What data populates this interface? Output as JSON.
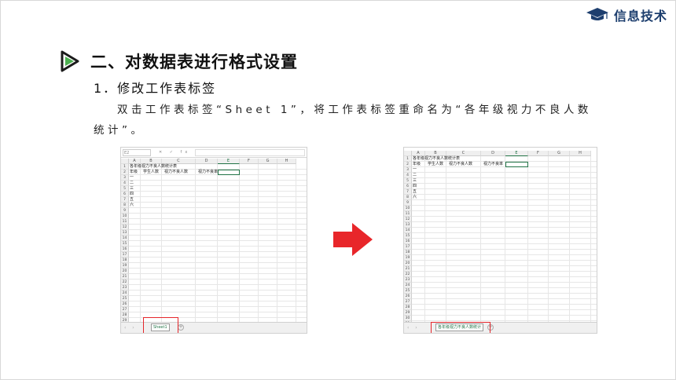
{
  "brand": {
    "text": "信息技术",
    "icon": "graduation-cap-icon",
    "color": "#1d3e6e"
  },
  "heading": {
    "icon": "play-triangle-icon",
    "title": "二、对数据表进行格式设置"
  },
  "subheading": "1．修改工作表标签",
  "paragraph": "双击工作表标签“Sheet 1”，将工作表标签重命名为“各年级视力不良人数统计”。",
  "colors": {
    "accent_green": "#217346",
    "highlight_red": "#e5262b",
    "arrow_red": "#e8262a"
  },
  "left_sheet": {
    "namebox": "E2",
    "fx": "✕ ✓ fx",
    "columns": [
      "A",
      "B",
      "C",
      "D",
      "E",
      "F",
      "G",
      "H"
    ],
    "selected_column": "E",
    "row_count": 30,
    "title_cell": "各年级视力不良人数统计表",
    "header_row": [
      "年级",
      "学生人数",
      "视力不良人数",
      "视力不良率"
    ],
    "grades": [
      "一",
      "二",
      "三",
      "四",
      "五",
      "六"
    ],
    "tab_label": "Sheet1",
    "tab_plus": "+"
  },
  "right_sheet": {
    "columns": [
      "A",
      "B",
      "C",
      "D",
      "E",
      "F",
      "G",
      "H"
    ],
    "selected_column": "E",
    "row_count": 31,
    "title_cell": "各年级视力不良人数统计表",
    "header_row": [
      "年级",
      "学生人数",
      "视力不良人数",
      "视力不良率"
    ],
    "grades": [
      "一",
      "二",
      "三",
      "四",
      "五",
      "六"
    ],
    "tab_label": "各年级视力不良人数统计",
    "tab_plus": "+"
  }
}
